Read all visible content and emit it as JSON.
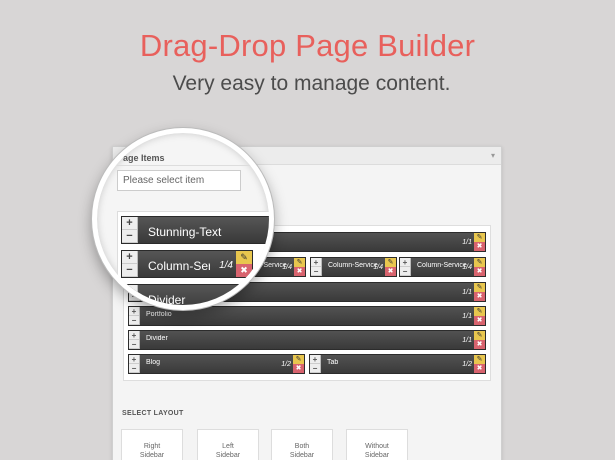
{
  "hero": {
    "title": "Drag-Drop Page Builder",
    "subtitle": "Very easy to manage content."
  },
  "panel": {
    "header": "Page Items",
    "select_placeholder": "Please select item",
    "add_label": "✔"
  },
  "rows": [
    {
      "label": "Stunning-Text",
      "size": "1/1"
    },
    {
      "label": "Column-Service",
      "size": "1/4"
    },
    {
      "label": "Column-Service",
      "size": "1/4"
    },
    {
      "label": "Column-Service",
      "size": "1/4"
    },
    {
      "label": "Column-Service",
      "size": "1/4"
    },
    {
      "label": "Divider",
      "size": "1/1"
    },
    {
      "label": "Portfolio",
      "size": "1/1"
    },
    {
      "label": "Divider",
      "size": "1/1"
    },
    {
      "label": "Blog",
      "size": "1/2"
    },
    {
      "label": "Tab",
      "size": "1/2"
    }
  ],
  "controls": {
    "plus": "+",
    "minus": "−",
    "edit": "✎",
    "delete": "✖"
  },
  "layout": {
    "title": "SELECT LAYOUT",
    "options": [
      {
        "line1": "Right",
        "line2": "Sidebar"
      },
      {
        "line1": "Left",
        "line2": "Sidebar"
      },
      {
        "line1": "Both",
        "line2": "Sidebar"
      },
      {
        "line1": "Without",
        "line2": "Sidebar"
      }
    ]
  },
  "colors": {
    "title": "#e8605c",
    "subtitle": "#4c4c4c",
    "bar": "#444444",
    "edit": "#e8c64e",
    "delete": "#d8636e",
    "add": "#7dbf3a"
  }
}
